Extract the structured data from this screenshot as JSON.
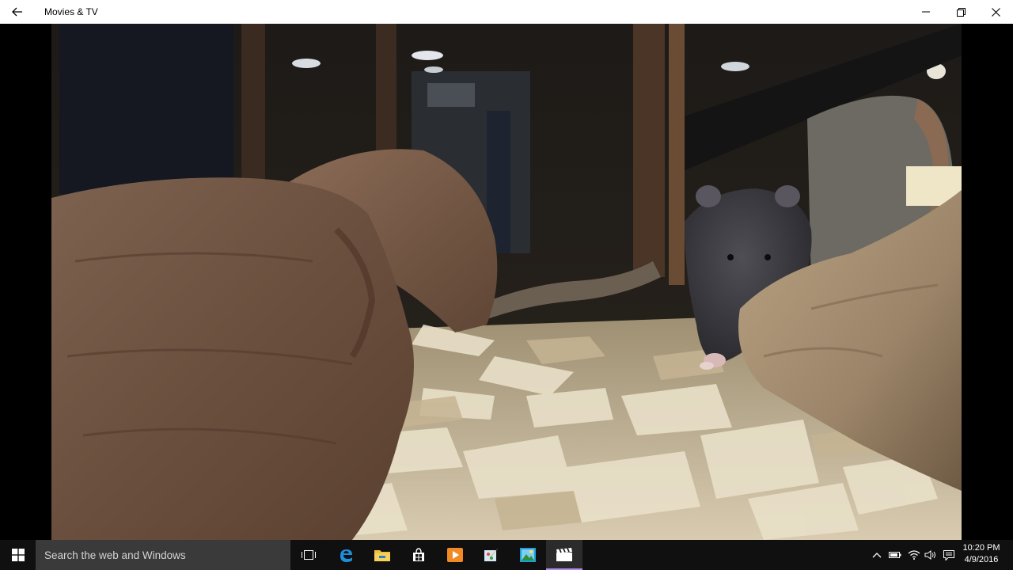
{
  "window": {
    "title": "Movies & TV",
    "back_icon": "back-arrow-icon",
    "controls": [
      "minimize-icon",
      "restore-icon",
      "close-icon"
    ]
  },
  "video": {
    "description_icon": "video-frame",
    "colors": {
      "letterbox": "#000000"
    }
  },
  "taskbar": {
    "search_placeholder": "Search the web and Windows",
    "pinned": [
      "task-view-icon",
      "edge-icon",
      "file-explorer-icon",
      "store-icon",
      "media-player-icon",
      "paint-icon",
      "photos-icon",
      "movies-tv-icon"
    ],
    "tray": [
      "chevron-up-icon",
      "battery-icon",
      "network-icon",
      "volume-icon",
      "notifications-icon"
    ],
    "clock": {
      "time": "10:20 PM",
      "date": "4/9/2016"
    },
    "colors": {
      "background": "#101010",
      "search_bg": "#3a3a3a",
      "active_accent": "#b18ce8"
    }
  }
}
